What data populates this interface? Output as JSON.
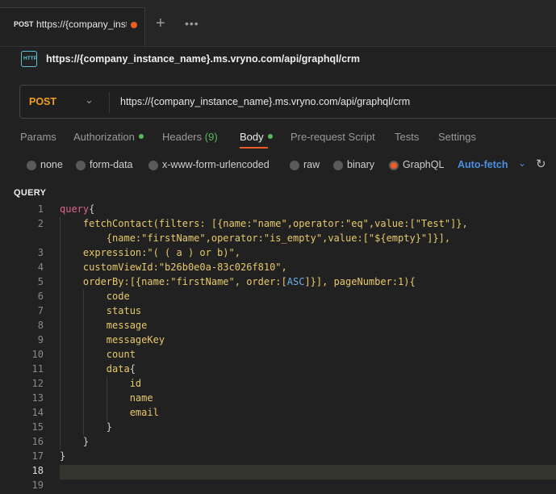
{
  "tab": {
    "method": "POST",
    "label": "https://{company_inst",
    "unsaved_dot_color": "#ef5b25"
  },
  "tabbar": {
    "new_tab_icon": "+",
    "more_icon": "•••"
  },
  "request": {
    "icon_text": "HTTP",
    "title": "https://{company_instance_name}.ms.vryno.com/api/graphql/crm",
    "method": "POST",
    "method_chevron": "⌄",
    "url": "https://{company_instance_name}.ms.vryno.com/api/graphql/crm"
  },
  "subtabs": {
    "params": "Params",
    "authorization": "Authorization",
    "headers": "Headers",
    "headers_count": "(9)",
    "body": "Body",
    "prerequest": "Pre-request Script",
    "tests": "Tests",
    "settings": "Settings"
  },
  "body_types": {
    "none": "none",
    "form_data": "form-data",
    "urlencoded": "x-www-form-urlencoded",
    "raw": "raw",
    "binary": "binary",
    "graphql": "GraphQL",
    "selected": "GraphQL",
    "auto_fetch": "Auto-fetch",
    "auto_fetch_chevron": "⌄",
    "refresh_icon": "↻"
  },
  "query_label": "QUERY",
  "editor": {
    "line_numbers": [
      "1",
      "2",
      "",
      "3",
      "4",
      "5",
      "6",
      "7",
      "8",
      "9",
      "10",
      "11",
      "12",
      "13",
      "14",
      "15",
      "16",
      "17",
      "18",
      "19"
    ],
    "active_line": "18",
    "lines": [
      [
        "query",
        "{"
      ],
      [
        "    fetchContact(filters: [{name:\"name\",operator:\"eq\",value:[\"Test\"]},"
      ],
      [
        "        {name:\"firstName\",operator:\"is_empty\",value:[\"${empty}\"]}],"
      ],
      [
        "    expression:\"( ( a ) or b)\","
      ],
      [
        "    customViewId:\"b26b0e0a-83c026f810\","
      ],
      [
        "    orderBy:[{name:\"firstName\", order:[",
        "ASC",
        "]}], pageNumber:1){"
      ],
      [
        "        code"
      ],
      [
        "        status"
      ],
      [
        "        message"
      ],
      [
        "        messageKey"
      ],
      [
        "        count"
      ],
      [
        "        data",
        "{"
      ],
      [
        "            id"
      ],
      [
        "            name"
      ],
      [
        "            email"
      ],
      [
        "        ",
        "}"
      ],
      [
        "    ",
        "}"
      ],
      [
        "",
        "}"
      ],
      [
        ""
      ],
      [
        ""
      ]
    ]
  }
}
